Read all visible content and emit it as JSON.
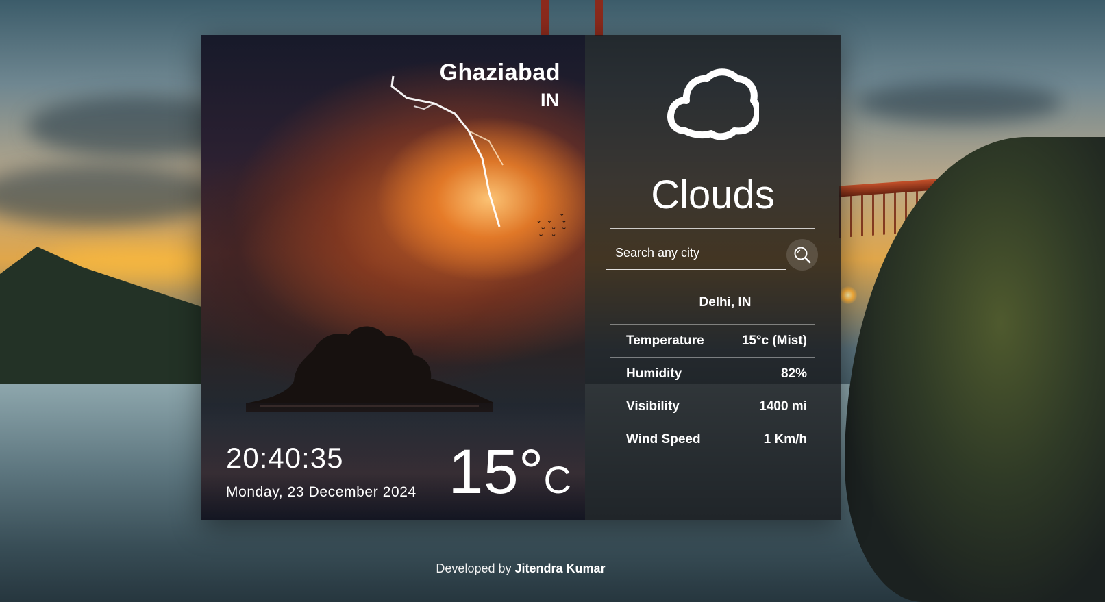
{
  "location": {
    "city": "Ghaziabad",
    "country": "IN"
  },
  "time": {
    "clock": "20:40:35",
    "date": "Monday, 23 December 2024"
  },
  "temperature": {
    "value": "15",
    "degree_symbol": "°",
    "unit": "C"
  },
  "weather": {
    "condition": "Clouds",
    "icon": "cloud-icon"
  },
  "search": {
    "placeholder": "Search any city",
    "button_icon": "search-icon"
  },
  "selected_city": "Delhi, IN",
  "stats": [
    {
      "label": "Temperature",
      "value": "15°c (Mist)"
    },
    {
      "label": "Humidity",
      "value": "82%"
    },
    {
      "label": "Visibility",
      "value": "1400 mi"
    },
    {
      "label": "Wind Speed",
      "value": "1 Km/h"
    }
  ],
  "footer": {
    "prefix": "Developed by",
    "author": "Jitendra Kumar"
  },
  "colors": {
    "panel_dark": "#161618",
    "sky_orange": "#e0a64a",
    "text": "#ffffff"
  }
}
